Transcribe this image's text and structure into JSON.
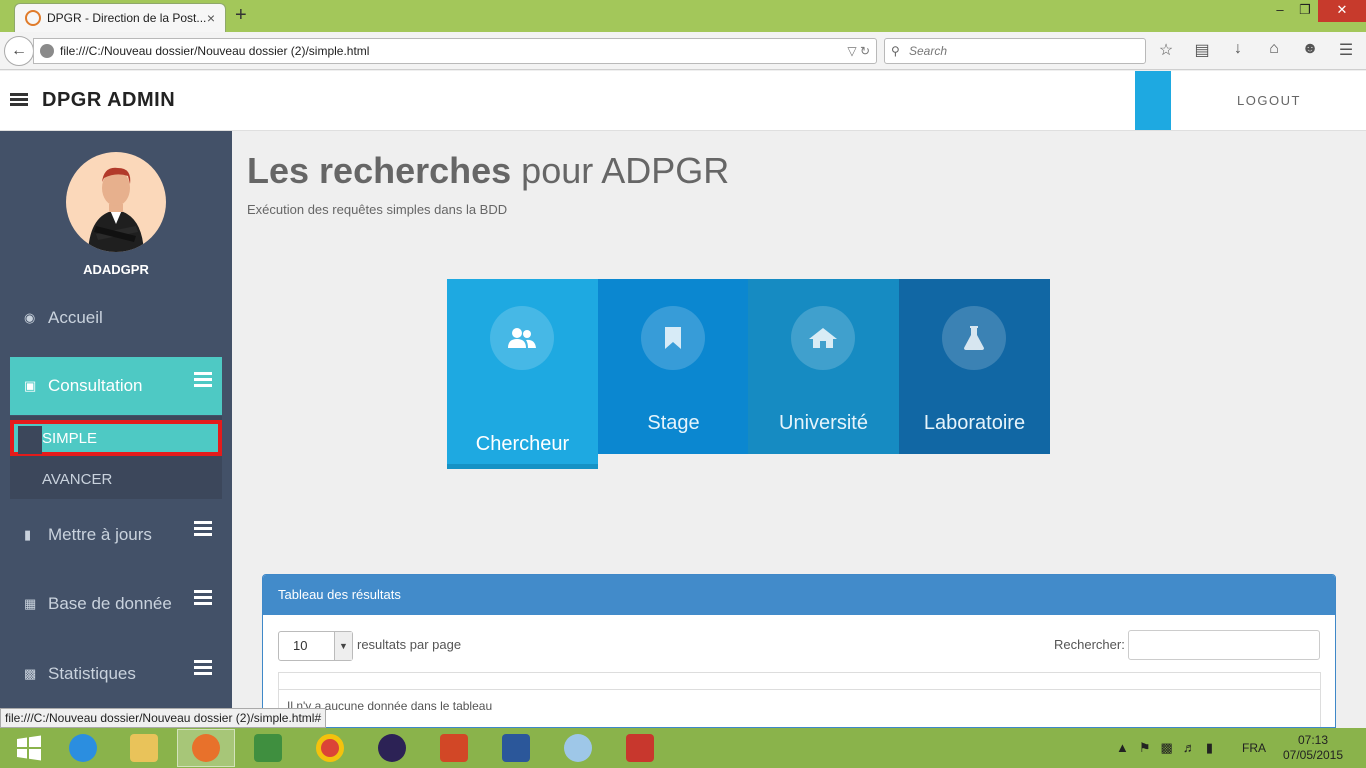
{
  "browser": {
    "tab_title": "DPGR - Direction de la Post...",
    "tab_close": "×",
    "new_tab": "+",
    "url": "file:///C:/Nouveau dossier/Nouveau dossier (2)/simple.html",
    "search_placeholder": "Search",
    "window_controls": {
      "minimize": "–",
      "maximize": "❐",
      "close": "✕"
    },
    "status_url": "file:///C:/Nouveau dossier/Nouveau dossier (2)/simple.html#"
  },
  "header": {
    "brand": "DPGR ADMIN",
    "logout": "LOGOUT",
    "accent_color": "#1ea9e1"
  },
  "sidebar": {
    "username": "ADADGPR",
    "items": [
      {
        "label": "Accueil",
        "icon": "dashboard-icon"
      },
      {
        "label": "Consultation",
        "icon": "monitor-icon",
        "active": true
      },
      {
        "label": "Mettre à jours",
        "icon": "book-icon"
      },
      {
        "label": "Base de donnée",
        "icon": "grid-icon"
      },
      {
        "label": "Statistiques",
        "icon": "chart-icon"
      }
    ],
    "submenu": [
      "SIMPLE",
      "AVANCER"
    ],
    "active_color": "#4ec9c4",
    "bg_color": "#435168"
  },
  "main": {
    "title_bold": "Les recherches",
    "title_rest": " pour ADPGR",
    "subtitle": "Exécution des requêtes simples dans la BDD",
    "tiles": [
      {
        "label": "Chercheur",
        "icon": "users-icon",
        "color": "#1ea9e1"
      },
      {
        "label": "Stage",
        "icon": "bookmark-icon",
        "color": "#0b87d0"
      },
      {
        "label": "Université",
        "icon": "home-icon",
        "color": "#168bc2"
      },
      {
        "label": "Laboratoire",
        "icon": "flask-icon",
        "color": "#1167a4"
      }
    ]
  },
  "results": {
    "title": "Tableau des résultats",
    "page_size": "10",
    "page_size_label": "resultats par page",
    "search_label": "Rechercher:",
    "empty_message": "Il n'y a aucune donnée dans le tableau"
  },
  "taskbar": {
    "apps": [
      "start",
      "internet-explorer",
      "file-explorer",
      "firefox",
      "project",
      "chrome",
      "eclipse",
      "powerpoint",
      "word",
      "paint",
      "app"
    ],
    "language": "FRA",
    "time": "07:13",
    "date": "07/05/2015"
  }
}
